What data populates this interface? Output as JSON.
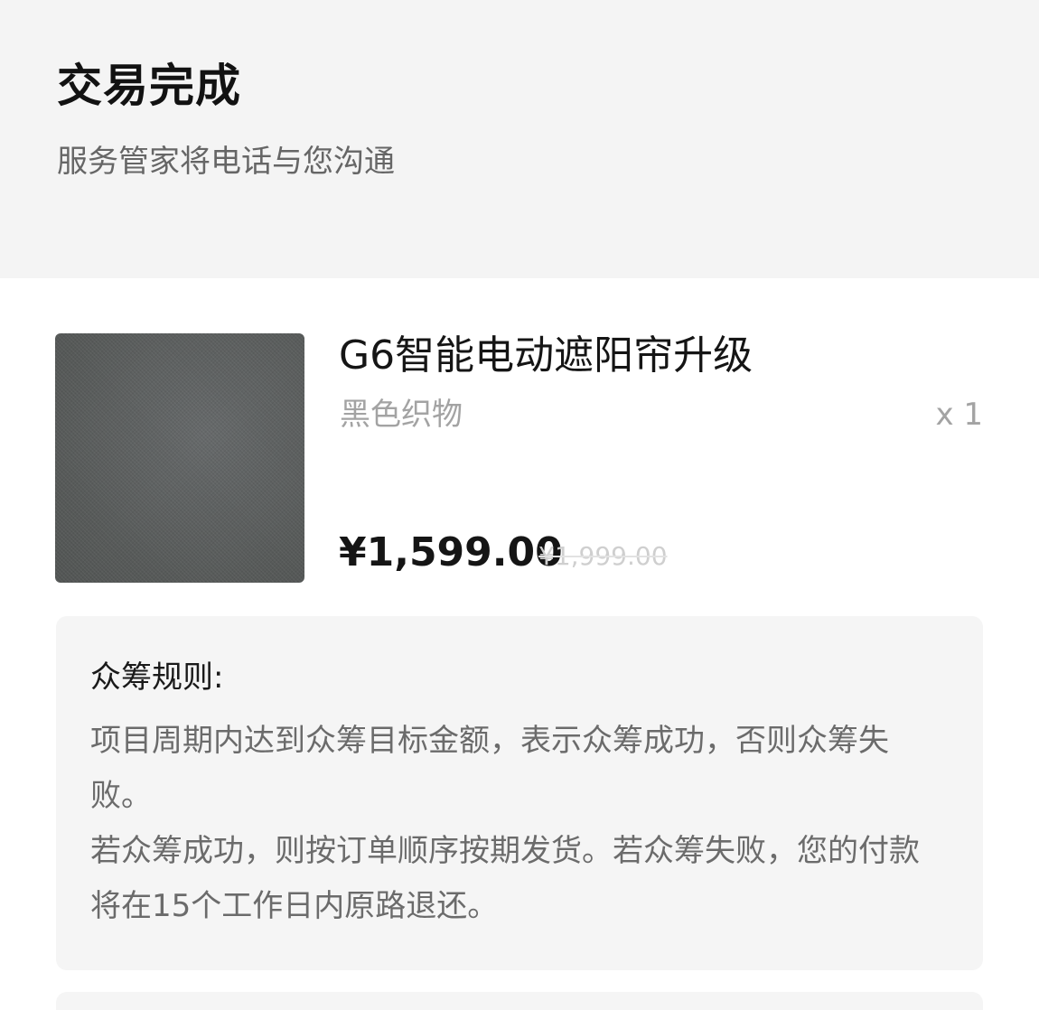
{
  "order_status": {
    "title": "交易完成",
    "subtitle": "服务管家将电话与您沟通"
  },
  "product": {
    "image_icon": "product-fabric-swatch",
    "name": "G6智能电动遮阳帘升级",
    "variant": "黑色织物",
    "quantity": "x 1",
    "price_current": "¥1,599.00",
    "price_original": "¥1,999.00"
  },
  "crowdfunding_rules": {
    "title": "众筹规则:",
    "paragraphs": [
      "项目周期内达到众筹目标金额，表示众筹成功，否则众筹失败。",
      "若众筹成功，则按订单顺序按期发货。若众筹失败，您的付款将在15个工作日内原路退还。"
    ]
  },
  "colors": {
    "header_bg": "#f4f4f4",
    "rules_bg": "#f5f5f5",
    "primary_text": "#151515",
    "secondary_text": "#a3a3a3"
  }
}
